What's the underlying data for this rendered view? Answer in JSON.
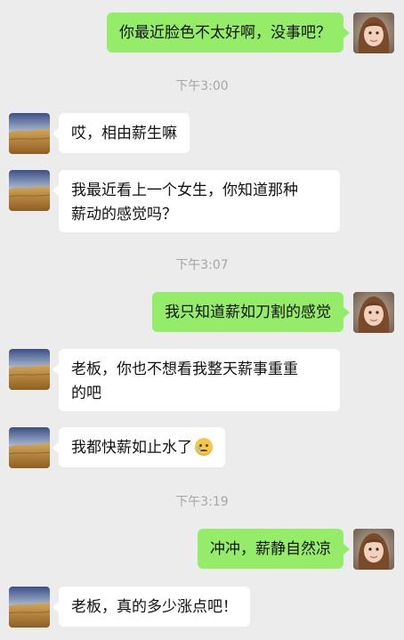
{
  "colors": {
    "background": "#ececec",
    "outgoing_bubble": "#95ec69",
    "incoming_bubble": "#ffffff",
    "timestamp_text": "#a6a6a6"
  },
  "avatars": {
    "me": "girl-portrait-avatar",
    "contact": "desert-landscape-avatar"
  },
  "timestamps": [
    "下午3:00",
    "下午3:07",
    "下午3:19"
  ],
  "messages": [
    {
      "side": "out",
      "text": "你最近脸色不太好啊，没事吧？"
    },
    {
      "side": "in",
      "text": "哎，相由薪生嘛"
    },
    {
      "side": "in",
      "text": "我最近看上一个女生，你知道那种\n薪动的感觉吗？"
    },
    {
      "side": "out",
      "text": "我只知道薪如刀割的感觉"
    },
    {
      "side": "in",
      "text": "老板，你也不想看我整天薪事重重\n的吧"
    },
    {
      "side": "in",
      "text": "我都快薪如止水了",
      "emoji": "sad-tear-emoji"
    },
    {
      "side": "out",
      "text": "冲冲，薪静自然凉"
    },
    {
      "side": "in",
      "text": "老板，真的多少涨点吧！"
    }
  ]
}
